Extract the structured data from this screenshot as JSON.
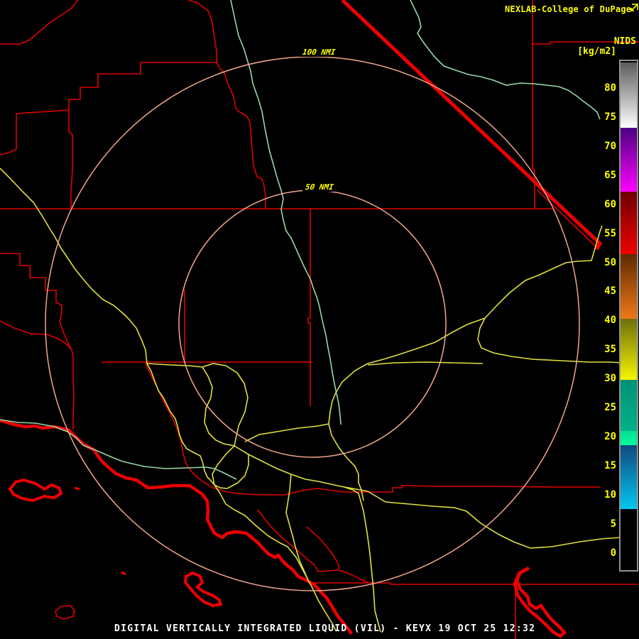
{
  "header": {
    "brand": "NEXLAB-College of DuPage",
    "icon": "external-link-icon"
  },
  "colorbar": {
    "title": "NIDS",
    "units": "[kg/m2]",
    "tick_values": [
      80,
      75,
      70,
      65,
      60,
      55,
      50,
      45,
      40,
      35,
      30,
      25,
      20,
      15,
      10,
      5,
      0
    ],
    "tick_y_zero": 779.5,
    "tick_y_per_unit": 8.18,
    "segments": [
      {
        "from": 2,
        "to": 94,
        "c1": "#5c5c5c",
        "c2": "#ffffff",
        "desc": "gray"
      },
      {
        "from": 94,
        "to": 184,
        "c1": "#4b0082",
        "c2": "#ff00ff",
        "desc": "purple-magenta"
      },
      {
        "from": 184,
        "to": 272,
        "c1": "#6e0000",
        "c2": "#f20000",
        "desc": "dark-to-bright red"
      },
      {
        "from": 272,
        "to": 363,
        "c1": "#5e2a00",
        "c2": "#f07818",
        "desc": "brown-orange"
      },
      {
        "from": 363,
        "to": 449,
        "c1": "#6f6f10",
        "c2": "#f5f500",
        "desc": "olive-yellow"
      },
      {
        "from": 449,
        "to": 521,
        "c1": "#00927a",
        "c2": "#00b286",
        "desc": "teal"
      },
      {
        "from": 521,
        "to": 541,
        "c1": "#00e090",
        "c2": "#00ff9e",
        "desc": "spring-green"
      },
      {
        "from": 541,
        "to": 631,
        "c1": "#12497f",
        "c2": "#00c8f0",
        "desc": "blue-cyan"
      },
      {
        "from": 631,
        "to": 713,
        "c1": "#000000",
        "c2": "#000000",
        "desc": "black"
      }
    ]
  },
  "rings": {
    "outer_label": "100 NMI",
    "inner_label": "50 NMI"
  },
  "footer": {
    "title": "DIGITAL VERTICALLY INTEGRATED LIQUID (VIL) - KEYX 19 OCT 25 12:32"
  },
  "palette": {
    "background": "#000000",
    "county_line_red": "#e00000",
    "coast_thick_red": "#ee0000",
    "road_yellow": "#e0e040",
    "river_green": "#96d8a8",
    "range_ring_salmon": "#f2a58d",
    "label_yellow": "#ffff00",
    "title_white": "#ffffff",
    "bar_border_gray": "#909090"
  }
}
